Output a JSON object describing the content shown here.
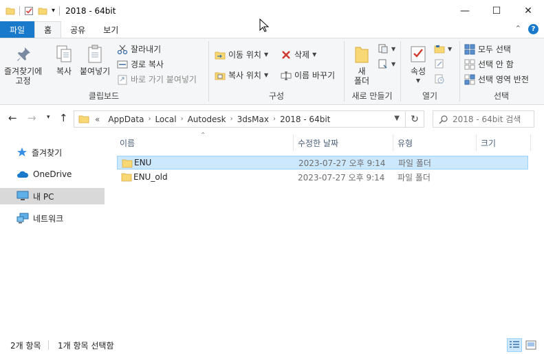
{
  "window": {
    "title": "2018 - 64bit",
    "minimize": "—",
    "maximize": "☐",
    "close": "✕"
  },
  "tabs": {
    "file": "파일",
    "home": "홈",
    "share": "공유",
    "view": "보기"
  },
  "ribbon": {
    "clipboard": {
      "title": "클립보드",
      "pin": "즐겨찾기에\n고정",
      "pin_l1": "즐겨찾기에",
      "pin_l2": "고정",
      "copy": "복사",
      "paste": "붙여넣기",
      "cut": "잘라내기",
      "copy_path": "경로 복사",
      "paste_shortcut": "바로 가기 붙여넣기"
    },
    "organize": {
      "title": "구성",
      "move_to": "이동 위치",
      "copy_to": "복사 위치",
      "delete": "삭제",
      "rename": "이름 바꾸기"
    },
    "new": {
      "title": "새로 만들기",
      "new_folder_l1": "새",
      "new_folder_l2": "폴더"
    },
    "open": {
      "title": "열기",
      "properties": "속성"
    },
    "select": {
      "title": "선택",
      "select_all": "모두 선택",
      "select_none": "선택 안 함",
      "invert": "선택 영역 반전"
    }
  },
  "address": {
    "prefix": "«",
    "crumbs": [
      "AppData",
      "Local",
      "Autodesk",
      "3dsMax",
      "2018 - 64bit"
    ]
  },
  "search": {
    "placeholder": "2018 - 64bit 검색"
  },
  "nav": {
    "items": [
      {
        "label": "즐겨찾기",
        "icon": "star-icon"
      },
      {
        "label": "OneDrive",
        "icon": "cloud-icon"
      },
      {
        "label": "내 PC",
        "icon": "computer-icon"
      },
      {
        "label": "네트워크",
        "icon": "network-icon"
      }
    ]
  },
  "columns": {
    "name": "이름",
    "modified": "수정한 날짜",
    "type": "유형",
    "size": "크기"
  },
  "files": [
    {
      "name": "ENU",
      "modified": "2023-07-27 오후 9:14",
      "type": "파일 폴더"
    },
    {
      "name": "ENU_old",
      "modified": "2023-07-27 오후 9:14",
      "type": "파일 폴더"
    }
  ],
  "status": {
    "count": "2개 항목",
    "selected": "1개 항목 선택함"
  },
  "colors": {
    "accent": "#1979ca",
    "selection": "#cce8ff",
    "folder": "#f8d775"
  }
}
